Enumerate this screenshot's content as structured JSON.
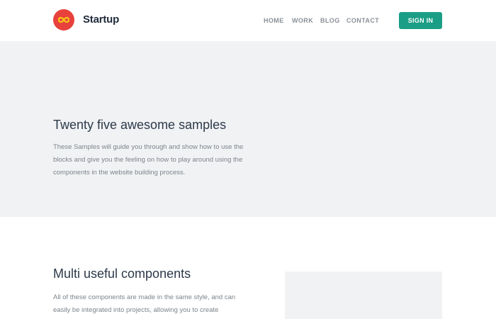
{
  "header": {
    "brand": "Startup",
    "nav": [
      "HOME",
      "WORK",
      "BLOG",
      "CONTACT"
    ],
    "signin_label": "SIGN IN",
    "logo_icon": "infinity-icon",
    "colors": {
      "accent": "#1a9e86",
      "logo_bg": "#e8413c",
      "logo_symbol": "#f5c518"
    }
  },
  "hero": {
    "title": "Twenty five awesome samples",
    "text": "These Samples will guide you through and show how to use the blocks and give you the feeling on how to play around using the components in the website building process.",
    "background": "#f1f2f4"
  },
  "section2": {
    "title": "Multi useful components",
    "text": "All of these components are made in the same style, and can easily be integrated into projects, allowing you to create"
  }
}
